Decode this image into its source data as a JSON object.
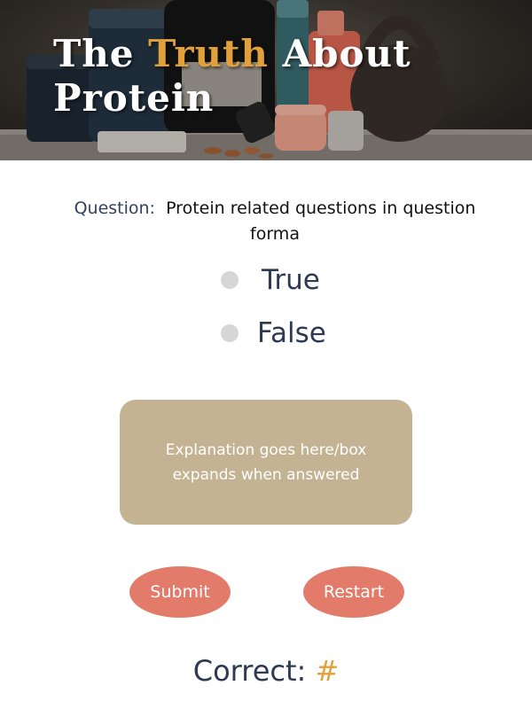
{
  "hero": {
    "title_part1": "The ",
    "title_accent": "Truth",
    "title_part2": " About Protein"
  },
  "question": {
    "label": "Question:",
    "text": "Protein related questions in question forma"
  },
  "options": [
    {
      "label": "True"
    },
    {
      "label": "False"
    }
  ],
  "explanation": {
    "text": "Explanation goes here/box expands when answered"
  },
  "buttons": {
    "submit": "Submit",
    "restart": "Restart"
  },
  "score": {
    "label": "Correct:",
    "value": "#"
  },
  "colors": {
    "accent": "#e2a03a",
    "explanation_box": "#c4b393",
    "button": "#e37b6b",
    "text_dark": "#2d3a52",
    "radio": "#d6d6d6"
  }
}
